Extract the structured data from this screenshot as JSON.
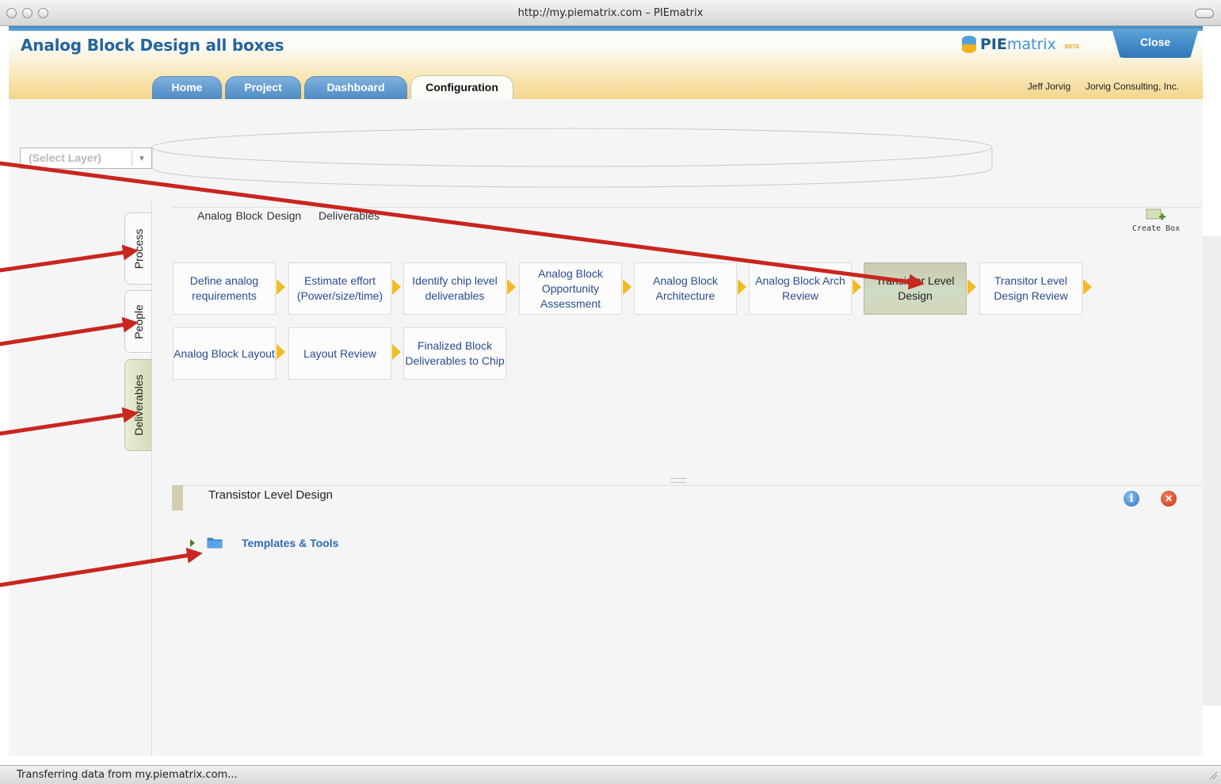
{
  "browser": {
    "window_title": "http://my.piematrix.com – PIEmatrix",
    "status_text": "Transferring data from my.piematrix.com..."
  },
  "header": {
    "app_title": "Analog Block Design all boxes",
    "logo_bold": "PIE",
    "logo_light": "matrix",
    "logo_badge": "BETA",
    "close_label": "Close",
    "user_name": "Jeff Jorvig",
    "company": "Jorvig Consulting, Inc.",
    "accent_color": "#24659e"
  },
  "nav": {
    "tabs": [
      {
        "label": "Home",
        "active": false
      },
      {
        "label": "Project",
        "active": false
      },
      {
        "label": "Dashboard",
        "active": false
      },
      {
        "label": "Configuration",
        "active": true
      }
    ]
  },
  "layer_select": {
    "value": "(Select Layer)"
  },
  "side_tabs": [
    {
      "label": "Process",
      "active": false
    },
    {
      "label": "People",
      "active": false
    },
    {
      "label": "Deliverables",
      "active": true
    }
  ],
  "breadcrumb": {
    "root": "Analog Block Design",
    "current": "Deliverables"
  },
  "create_box_label": "Create Box",
  "process_boxes": [
    {
      "label": "Define analog requirements",
      "selected": false
    },
    {
      "label": "Estimate effort (Power/size/time)",
      "selected": false
    },
    {
      "label": "Identify chip level deliverables",
      "selected": false
    },
    {
      "label": "Analog Block Opportunity Assessment",
      "selected": false
    },
    {
      "label": "Analog Block Architecture",
      "selected": false
    },
    {
      "label": "Analog Block Arch Review",
      "selected": false
    },
    {
      "label": "Transistor Level Design",
      "selected": true
    },
    {
      "label": "Transitor Level Design Review",
      "selected": false
    },
    {
      "label": "Analog Block Layout",
      "selected": false
    },
    {
      "label": "Layout Review",
      "selected": false
    },
    {
      "label": "Finalized Block Deliverables to Chip",
      "selected": false
    }
  ],
  "detail": {
    "title": "Transistor Level Design",
    "folder_label": "Templates & Tools",
    "info_icon": "info-icon",
    "delete_icon": "delete-icon"
  },
  "annotation_color": "#c8261f"
}
